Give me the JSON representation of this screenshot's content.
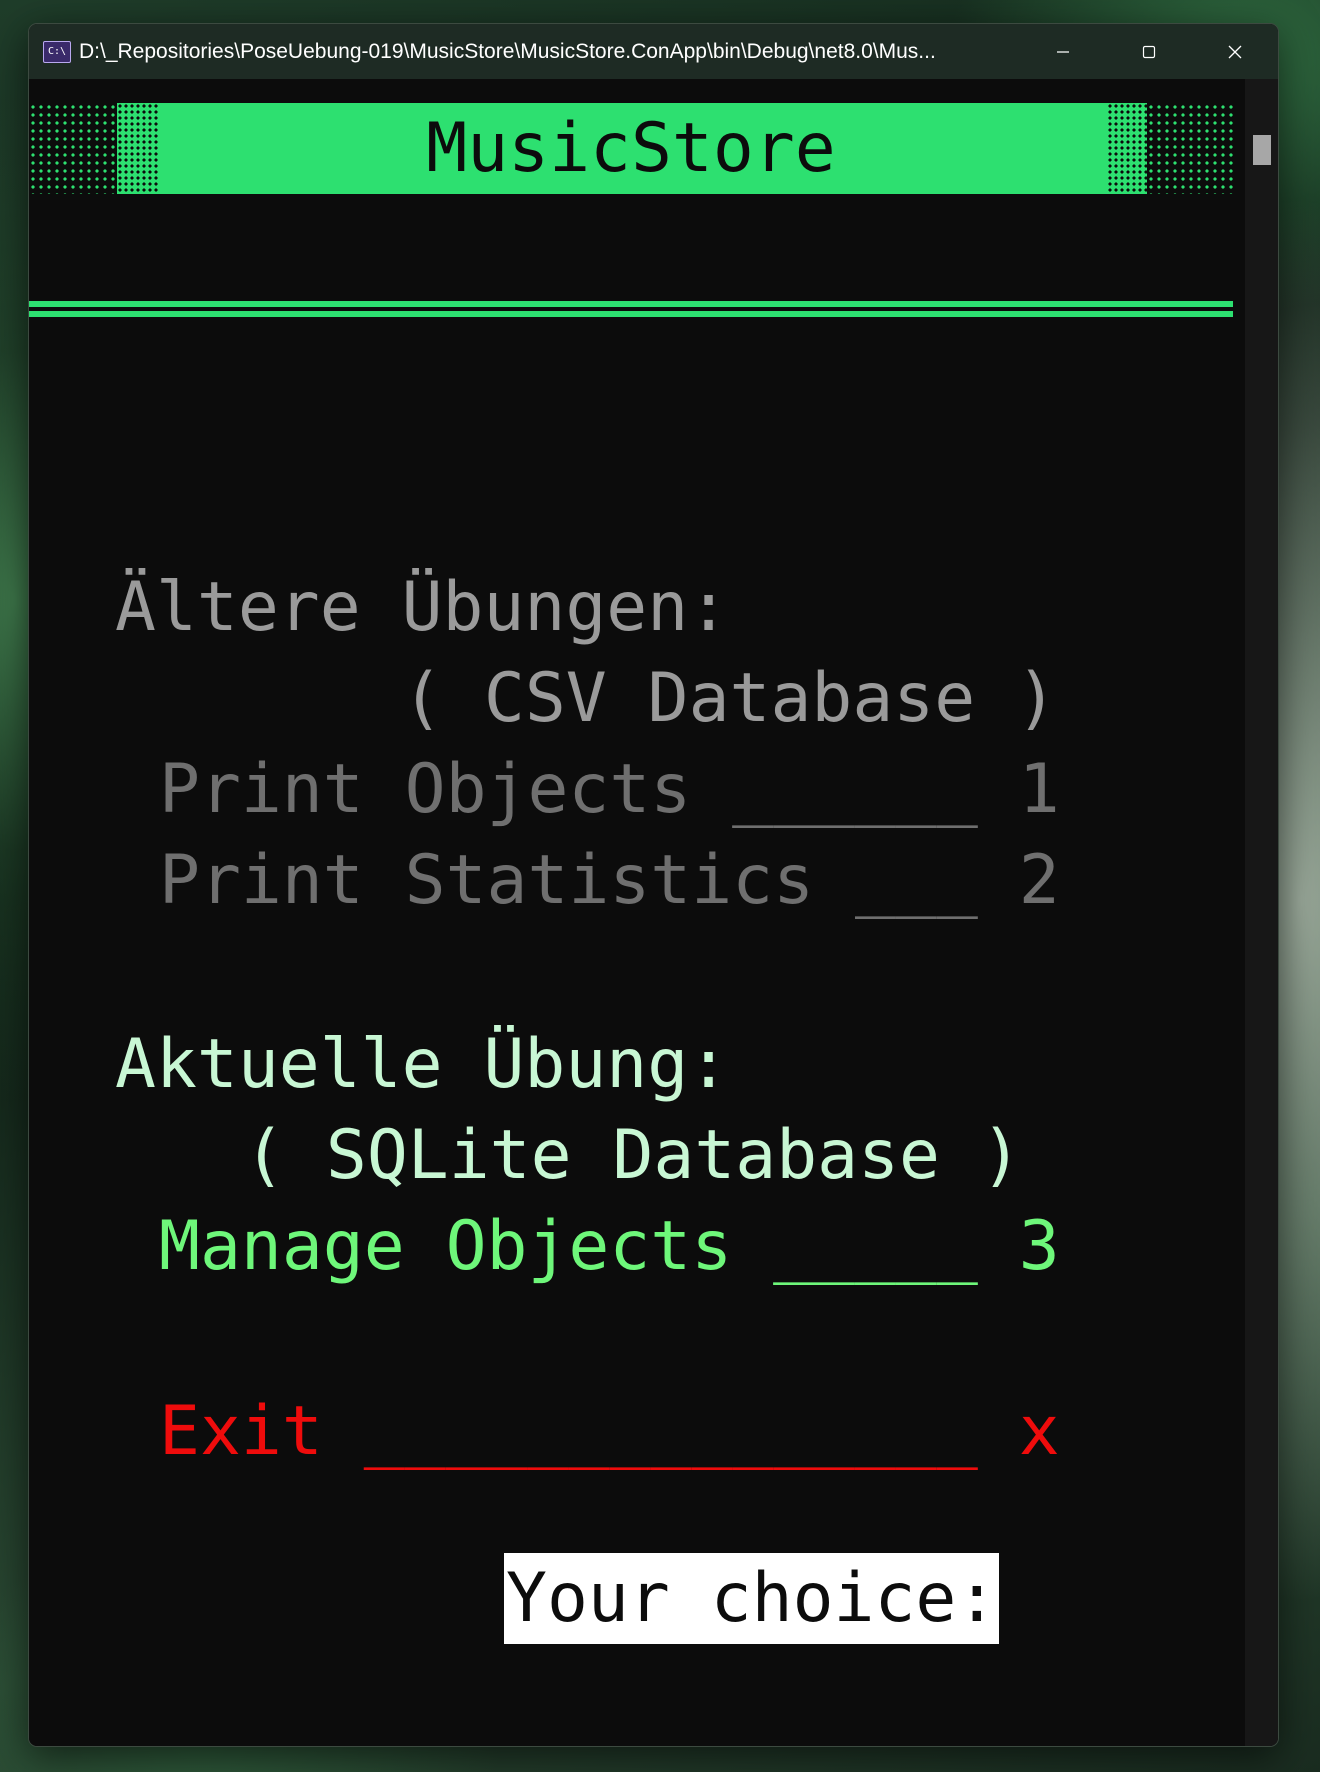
{
  "window": {
    "title": "D:\\_Repositories\\PoseUebung-019\\MusicStore\\MusicStore.ConApp\\bin\\Debug\\net8.0\\Mus...",
    "icon": "console-app-icon",
    "icon_text": "C:\\",
    "minimize_icon": "minimize-icon",
    "maximize_icon": "maximize-icon",
    "close_icon": "close-icon"
  },
  "console": {
    "app_title": "MusicStore",
    "older_header": "Ältere Übungen:",
    "older_sub": "( CSV Database )",
    "item1": "Print Objects ______ 1",
    "item2": "Print Statistics ___ 2",
    "current_header": "Aktuelle Übung:",
    "current_sub": "( SQLite Database )",
    "item3": "Manage Objects _____ 3",
    "exit": "Exit _______________ x",
    "prompt": "Your choice:"
  },
  "colors": {
    "accent_green": "#2de070",
    "menu_green": "#6ef77a",
    "mint": "#c8f7d4",
    "gray": "#9a9a9a",
    "dim_gray": "#6f6f6f",
    "exit_red": "#ef0c0c",
    "console_bg": "#0c0c0c"
  }
}
